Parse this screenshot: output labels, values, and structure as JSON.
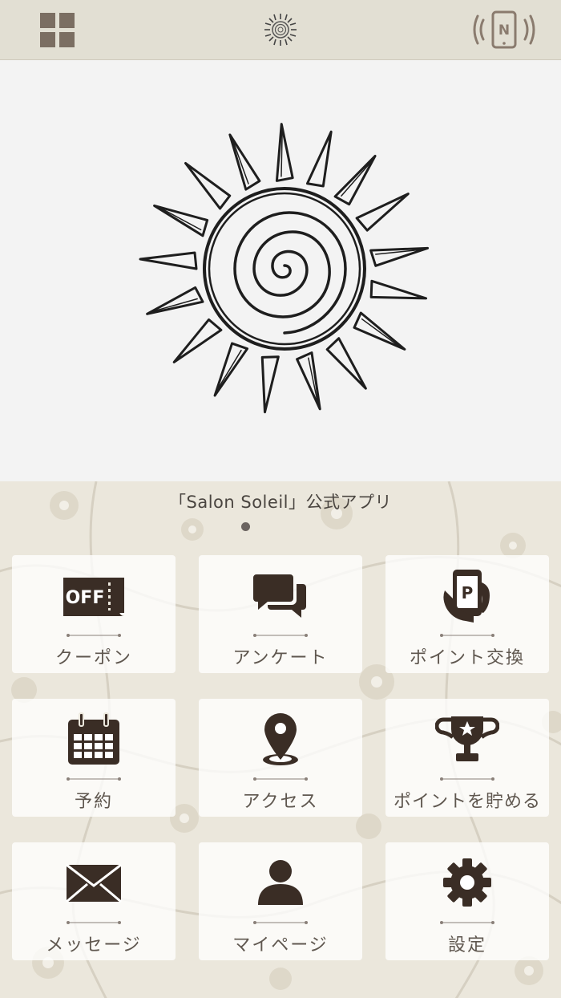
{
  "header": {
    "menu_icon": "grid-menu-icon",
    "logo_icon": "sun-logo-icon",
    "nfc_icon": "nfc-phone-icon",
    "nfc_letter": "N"
  },
  "hero": {
    "image": "sun-spiral-drawing"
  },
  "main": {
    "app_title": "「Salon Soleil」公式アプリ",
    "tiles": [
      {
        "label": "クーポン",
        "icon": "coupon-off-icon",
        "icon_text": "OFF"
      },
      {
        "label": "アンケート",
        "icon": "chat-bubbles-icon"
      },
      {
        "label": "ポイント交換",
        "icon": "hand-phone-points-icon",
        "icon_text": "P"
      },
      {
        "label": "予約",
        "icon": "calendar-icon"
      },
      {
        "label": "アクセス",
        "icon": "map-pin-icon"
      },
      {
        "label": "ポイントを貯める",
        "icon": "trophy-icon"
      },
      {
        "label": "メッセージ",
        "icon": "envelope-icon"
      },
      {
        "label": "マイページ",
        "icon": "person-icon"
      },
      {
        "label": "設定",
        "icon": "gear-icon"
      }
    ]
  },
  "colors": {
    "header_bg": "#e2dfd3",
    "icon_brown": "#3d3028",
    "label_text": "#5f574f"
  }
}
